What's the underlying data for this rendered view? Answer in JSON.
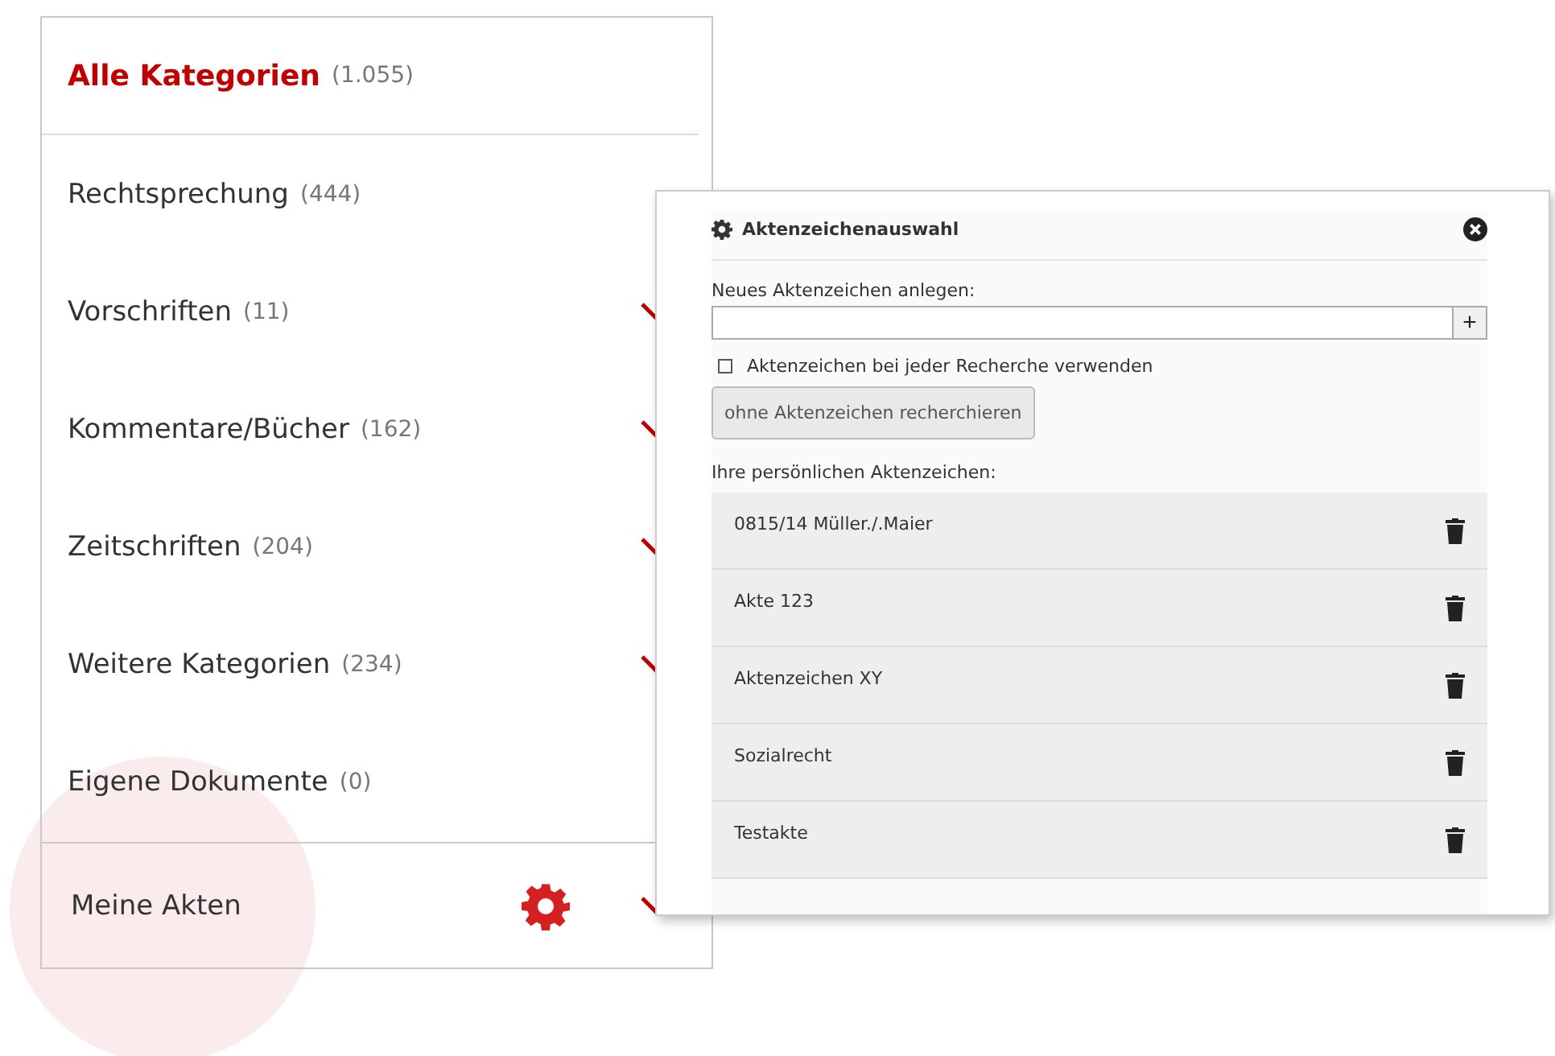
{
  "sidebar": {
    "header": {
      "label": "Alle Kategorien",
      "count": "(1.055)"
    },
    "items": [
      {
        "label": "Rechtsprechung",
        "count": "(444)",
        "expandable": false
      },
      {
        "label": "Vorschriften",
        "count": "(11)",
        "expandable": true
      },
      {
        "label": "Kommentare/Bücher",
        "count": "(162)",
        "expandable": true
      },
      {
        "label": "Zeitschriften",
        "count": "(204)",
        "expandable": true
      },
      {
        "label": "Weitere Kategorien",
        "count": "(234)",
        "expandable": true
      },
      {
        "label": "Eigene Dokumente",
        "count": "(0)",
        "expandable": false
      }
    ],
    "footer": {
      "label": "Meine Akten",
      "expandable": true
    }
  },
  "dialog": {
    "title": "Aktenzeichenauswahl",
    "new_label": "Neues Aktenzeichen anlegen:",
    "add_button": "+",
    "checkbox": {
      "label": "Aktenzeichen bei jeder Recherche verwenden",
      "checked": false
    },
    "search_button": "ohne Aktenzeichen recherchieren",
    "list_label": "Ihre persönlichen Aktenzeichen:",
    "files": [
      {
        "name": "0815/14 Müller./.Maier"
      },
      {
        "name": "Akte 123"
      },
      {
        "name": "Aktenzeichen XY"
      },
      {
        "name": "Sozialrecht"
      },
      {
        "name": "Testakte"
      }
    ]
  }
}
